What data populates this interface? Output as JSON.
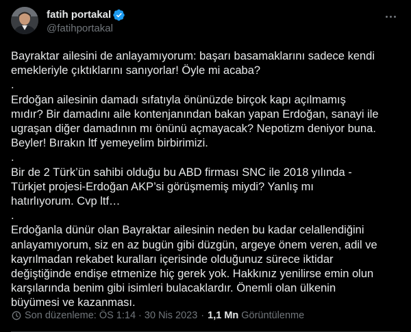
{
  "author": {
    "display_name": "fatih portakal",
    "handle": "@fatihportakal",
    "verified": true
  },
  "tweet": {
    "paragraphs": [
      "Bayraktar ailesini de anlayamıyorum: başarı basamaklarını sadece kendi\nemekleriyle çıktıklarını sanıyorlar! Öyle mi acaba?",
      ".",
      "Erdoğan ailesinin damadı sıfatıyla önünüzde birçok kapı açılmamış\nmıdır? Bir damadını aile kontenjanından bakan yapan Erdoğan, sanayi ile\nugraşan diğer damadının mı önünü açmayacak? Nepotizm deniyor buna.\nBeyler! Bırakın ltf yemeyelim birbirimizi.",
      ".",
      "Bir de 2 Türk’ün sahibi olduğu bu ABD firması SNC  ile 2018 yılında -\nTürkjet projesi-Erdoğan AKP’si görüşmemiş miydi? Yanlış mı\nhatırlıyorum. Cvp ltf…",
      ".",
      "Erdoğanla dünür olan Bayraktar ailesinin neden bu kadar celallendiğini\nanlayamıyorum, siz en az bugün gibi düzgün, argeye önem veren, adil ve\nkayrılmadan rekabet kuralları içerisinde olduğunuz sürece iktidar\ndeğiştiğinde endişe etmenize hiç gerek yok. Hakkınız yenilirse emin olun\nkarşılarında benim gibi isimleri bulacaklardır. Önemli olan ülkenin\nbüyümesi ve kazanması."
    ]
  },
  "footer": {
    "edited_label": "Son düzenleme: ÖS 1:14 · 30 Nis 2023",
    "separator": "·",
    "views_count": "1,1 Mn",
    "views_label": "Görüntülenme"
  },
  "colors": {
    "background": "#000000",
    "text": "#e7e9ea",
    "secondary": "#71767b",
    "verified": "#1d9bf0"
  }
}
